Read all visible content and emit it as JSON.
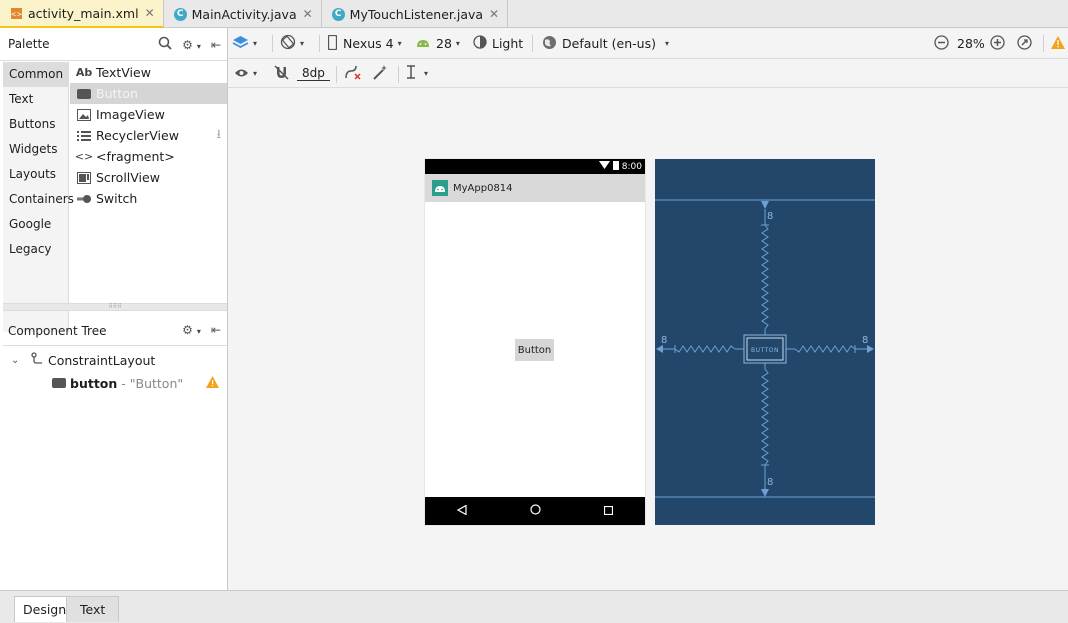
{
  "tabs": [
    {
      "label": "activity_main.xml",
      "type": "xml",
      "active": true
    },
    {
      "label": "MainActivity.java",
      "type": "java",
      "active": false
    },
    {
      "label": "MyTouchListener.java",
      "type": "java",
      "active": false
    }
  ],
  "palette": {
    "title": "Palette",
    "categories": [
      "Common",
      "Text",
      "Buttons",
      "Widgets",
      "Layouts",
      "Containers",
      "Google",
      "Legacy"
    ],
    "selected_category": "Common",
    "items": [
      {
        "icon": "Ab",
        "label": "TextView"
      },
      {
        "icon": "button",
        "label": "Button"
      },
      {
        "icon": "image",
        "label": "ImageView"
      },
      {
        "icon": "list",
        "label": "RecyclerView"
      },
      {
        "icon": "<>",
        "label": "<fragment>"
      },
      {
        "icon": "scroll",
        "label": "ScrollView"
      },
      {
        "icon": "switch",
        "label": "Switch"
      }
    ]
  },
  "component_tree": {
    "title": "Component Tree",
    "root": "ConstraintLayout",
    "child_name": "button",
    "child_text": " - \"Button\""
  },
  "toolbar": {
    "device": "Nexus 4",
    "api": "28",
    "theme": "Light",
    "locale": "Default (en-us)",
    "zoom": "28%",
    "margin": "8dp"
  },
  "phone": {
    "time": "8:00",
    "app_name": "MyApp0814",
    "button_label": "Button"
  },
  "blueprint": {
    "button_label": "BUTTON",
    "margin_label": "8",
    "bg_color": "#22476b",
    "line_color": "#6ea0d4"
  },
  "bottom_tabs": [
    "Design",
    "Text"
  ]
}
